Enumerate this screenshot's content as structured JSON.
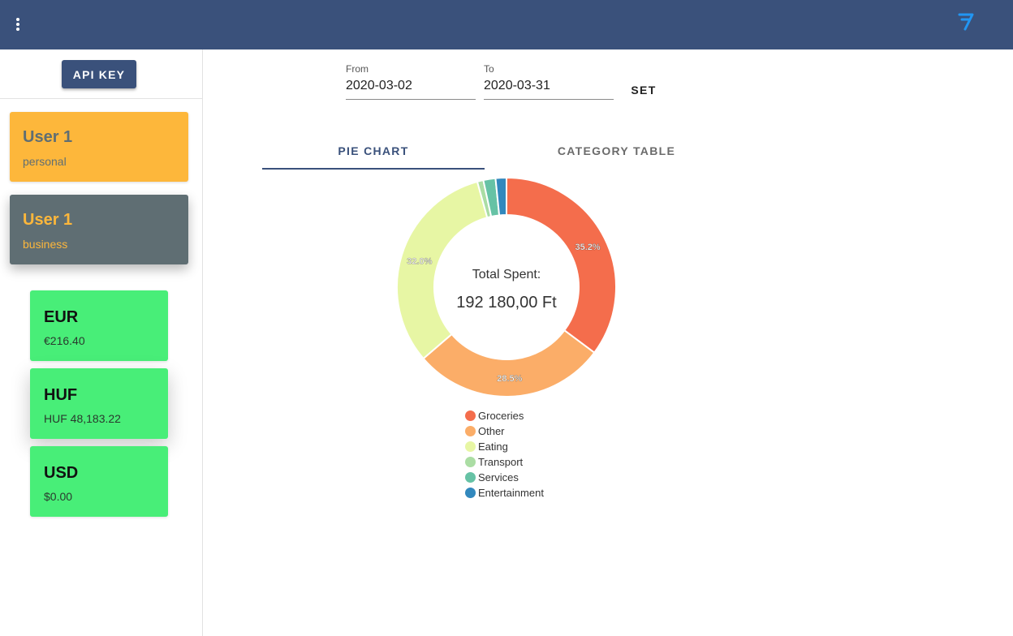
{
  "header": {
    "menu_icon": "more-vert-icon",
    "logo_icon": "wise-logo-icon",
    "logo_color": "#2196f3"
  },
  "sidebar": {
    "api_key_label": "API KEY",
    "profiles": [
      {
        "name": "User 1",
        "type": "personal"
      },
      {
        "name": "User 1",
        "type": "business"
      }
    ],
    "currencies": [
      {
        "code": "EUR",
        "amount": "€216.40"
      },
      {
        "code": "HUF",
        "amount": "HUF 48,183.22"
      },
      {
        "code": "USD",
        "amount": "$0.00"
      }
    ]
  },
  "filters": {
    "from_label": "From",
    "from_value": "2020-03-02",
    "to_label": "To",
    "to_value": "2020-03-31",
    "set_label": "SET"
  },
  "tabs": [
    {
      "label": "PIE CHART",
      "active": true
    },
    {
      "label": "CATEGORY TABLE",
      "active": false
    }
  ],
  "chart_data": {
    "type": "pie",
    "center_title": "Total Spent:",
    "center_value": "192 180,00 Ft",
    "slices": [
      {
        "name": "Groceries",
        "value": 35.2,
        "label": "35.2%",
        "color": "#f46d4c"
      },
      {
        "name": "Other",
        "value": 28.5,
        "label": "28.5%",
        "color": "#fbad68"
      },
      {
        "name": "Eating",
        "value": 32.0,
        "label": "32.0%",
        "color": "#e7f6a4"
      },
      {
        "name": "Transport",
        "value": 0.9,
        "label": "",
        "color": "#abdda4"
      },
      {
        "name": "Services",
        "value": 1.8,
        "label": "",
        "color": "#66c2a5"
      },
      {
        "name": "Entertainment",
        "value": 1.6,
        "label": "",
        "color": "#3288bd"
      }
    ]
  },
  "colors": {
    "primary": "#3a517b",
    "accent": "#fdb73b",
    "profile_dark": "#5f6e73",
    "currency_green": "#48ee78"
  }
}
